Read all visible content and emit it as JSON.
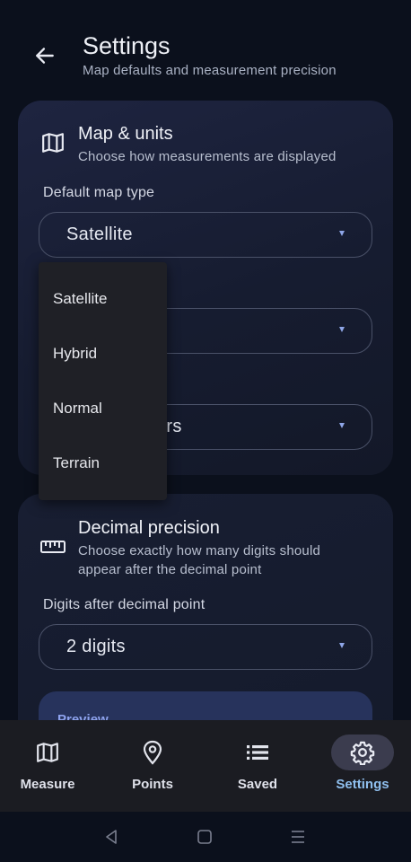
{
  "header": {
    "title": "Settings",
    "subtitle": "Map defaults and measurement precision"
  },
  "map_units_card": {
    "icon": "map-icon",
    "title": "Map & units",
    "description": "Choose how measurements are displayed",
    "default_map_type": {
      "label": "Default map type",
      "value": "Satellite"
    },
    "second_select": {
      "value": ""
    },
    "third_select": {
      "value_partial": "ers"
    }
  },
  "map_type_dropdown": {
    "options": [
      "Satellite",
      "Hybrid",
      "Normal",
      "Terrain"
    ]
  },
  "precision_card": {
    "icon": "ruler-icon",
    "title": "Decimal precision",
    "description": "Choose exactly how many digits should appear after the decimal point",
    "digits": {
      "label": "Digits after decimal point",
      "value": "2 digits"
    },
    "preview_label": "Preview"
  },
  "bottom_nav": {
    "items": [
      {
        "label": "Measure",
        "icon": "map-icon",
        "active": false
      },
      {
        "label": "Points",
        "icon": "location-pin-icon",
        "active": false
      },
      {
        "label": "Saved",
        "icon": "list-icon",
        "active": false
      },
      {
        "label": "Settings",
        "icon": "gear-icon",
        "active": true
      }
    ]
  },
  "colors": {
    "background": "#0b101c",
    "card": "#1c2240",
    "accent": "#8fbfee",
    "arrow": "#8fa6e8",
    "menu": "#1f2026"
  }
}
